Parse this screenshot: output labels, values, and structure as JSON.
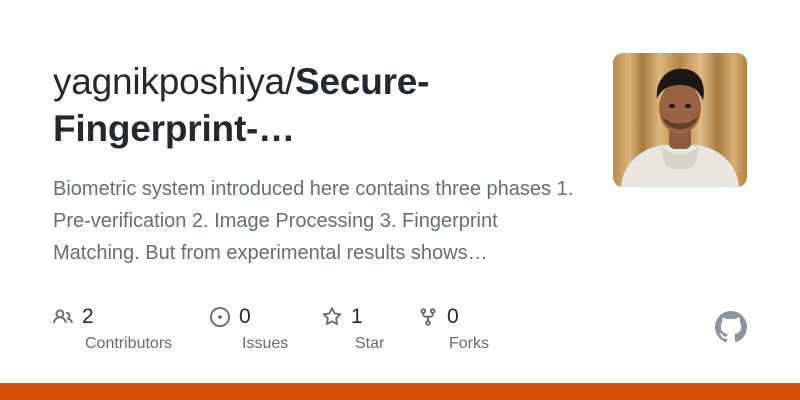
{
  "repo": {
    "owner_prefix": "yagnikposhiya/",
    "name_line1": "Secure-",
    "name_line2": "Fingerprint-…",
    "description": "Biometric system introduced here contains three phases 1. Pre-verification 2. Image Processing 3. Fingerprint Matching. But from experimental results shows…"
  },
  "stats": {
    "contributors": {
      "count": "2",
      "label": "Contributors",
      "icon": "people-icon"
    },
    "issues": {
      "count": "0",
      "label": "Issues",
      "icon": "issue-opened-icon"
    },
    "stars": {
      "count": "1",
      "label": "Star",
      "icon": "star-icon"
    },
    "forks": {
      "count": "0",
      "label": "Forks",
      "icon": "repo-forked-icon"
    }
  },
  "branding": {
    "logo": "github-mark-icon",
    "accent_bar_color": "#d7520f"
  }
}
